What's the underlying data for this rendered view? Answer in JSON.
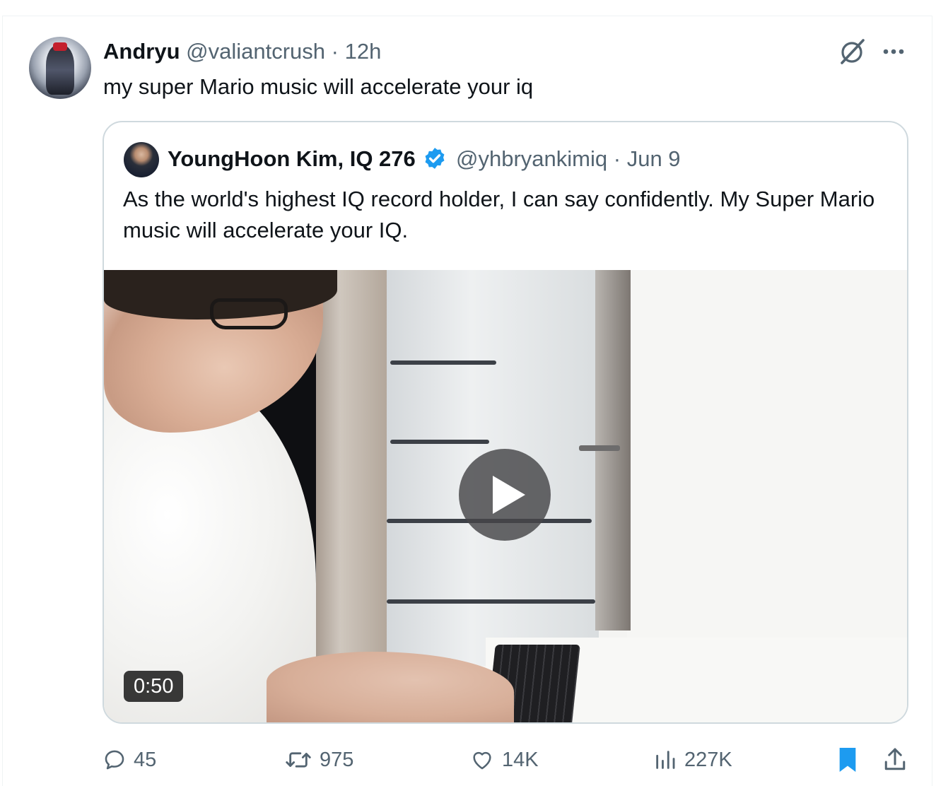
{
  "tweet": {
    "author_name": "Andryu",
    "author_handle": "@valiantcrush",
    "separator": "·",
    "time": "12h",
    "text": "my super Mario music will accelerate your iq"
  },
  "quote": {
    "author_name": "YoungHoon Kim, IQ 276",
    "author_handle": "@yhbryankimiq",
    "separator": "·",
    "date": "Jun 9",
    "text": "As the world's highest IQ record holder, I can say confidently. My Super Mario music will accelerate your IQ.",
    "video_duration": "0:50",
    "verified_color": "#1d9bf0"
  },
  "actions": {
    "replies": "45",
    "reposts": "975",
    "likes": "14K",
    "views": "227K"
  },
  "colors": {
    "secondary_text": "#536471",
    "primary_text": "#0f1419",
    "bookmark_active": "#1d9bf0",
    "border": "#cfd9de"
  },
  "icons": {
    "grok": "grok-icon",
    "more": "more-icon",
    "reply": "reply-icon",
    "repost": "repost-icon",
    "like": "heart-icon",
    "views": "views-icon",
    "bookmark": "bookmark-icon",
    "share": "share-icon",
    "play": "play-icon",
    "verified": "verified-badge-icon"
  }
}
